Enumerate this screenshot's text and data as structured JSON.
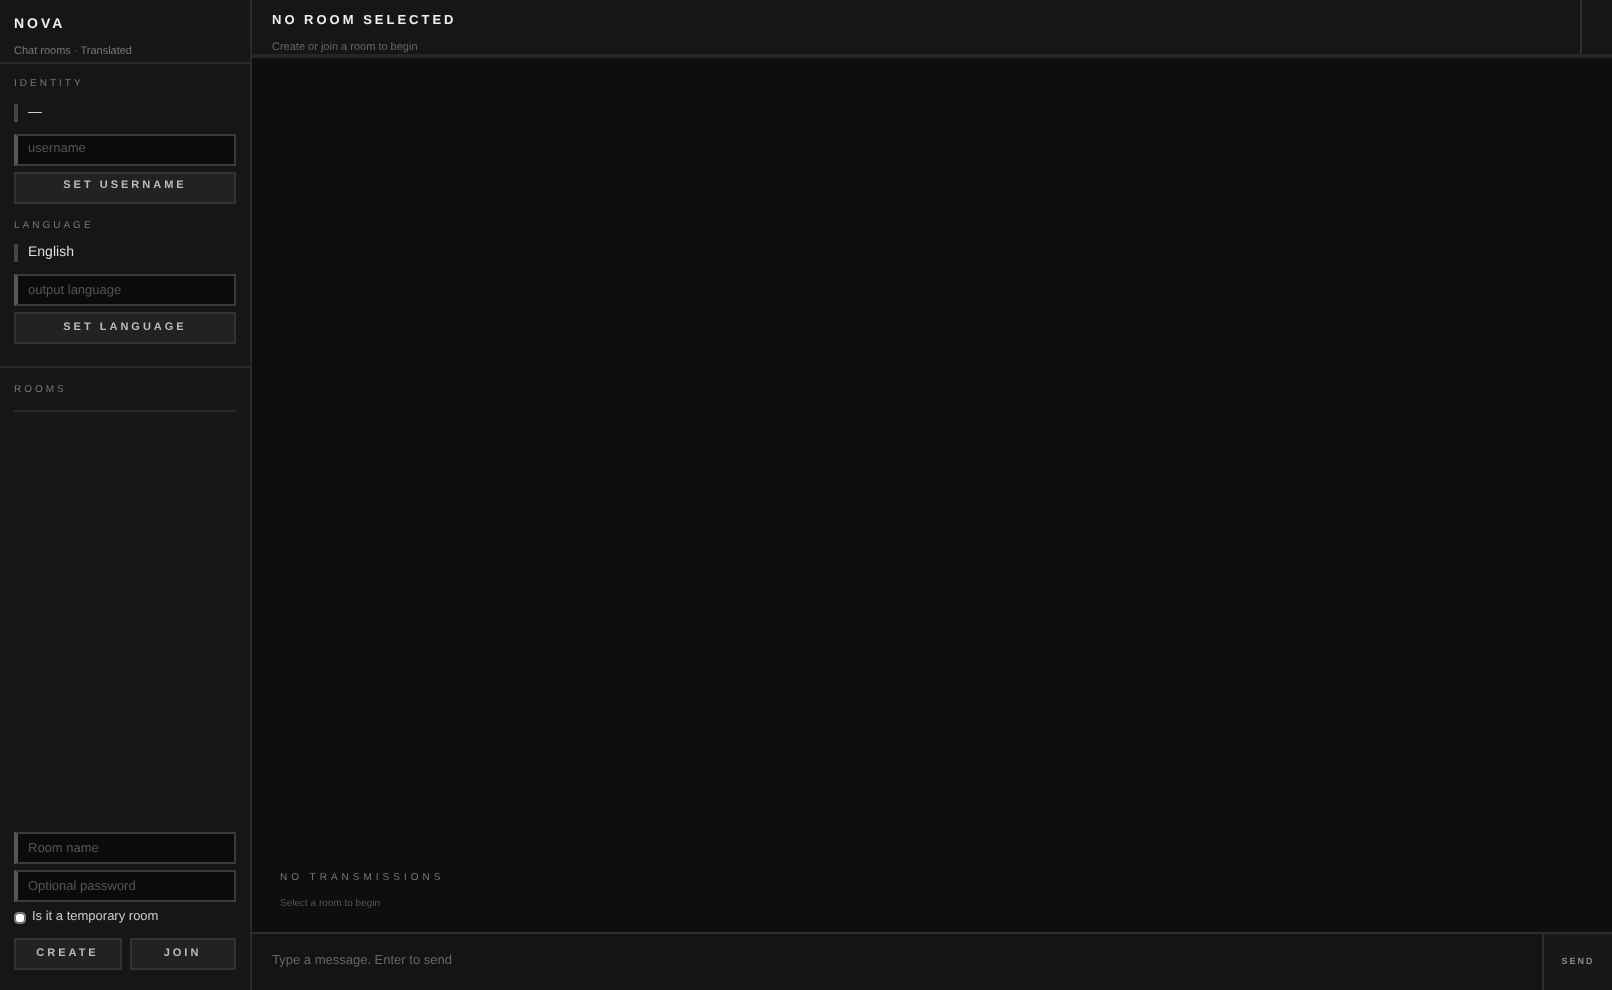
{
  "sidebar": {
    "brand": "NOVA",
    "subtitle": "Chat rooms · Translated",
    "identity": {
      "heading": "IDENTITY",
      "value": "—",
      "username_placeholder": "username",
      "button": "SET USERNAME"
    },
    "language": {
      "heading": "LANGUAGE",
      "value": "English",
      "placeholder": "output language",
      "button": "SET LANGUAGE"
    },
    "rooms": {
      "heading": "ROOMS"
    },
    "room_form": {
      "name_placeholder": "Room name",
      "password_placeholder": "Optional password",
      "temporary": {
        "label": "Is it a temporary room",
        "checked": false
      },
      "buttons": [
        "CREATE",
        "JOIN"
      ]
    }
  },
  "header": {
    "title": "NO ROOM SELECTED",
    "subtitle": "Create or join a room to begin"
  },
  "empty_state": {
    "title": "NO TRANSMISSIONS",
    "subtitle": "Select a room to begin"
  },
  "composer": {
    "placeholder": "Type a message. Enter to send",
    "button": "SEND"
  }
}
